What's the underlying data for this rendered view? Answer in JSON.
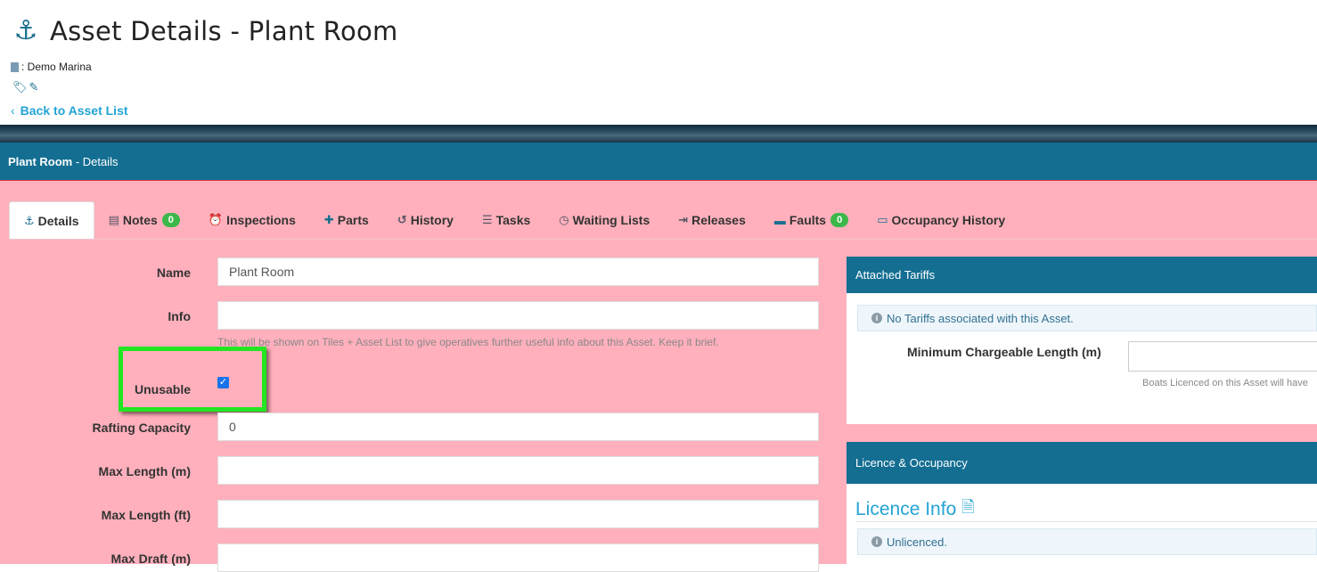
{
  "header": {
    "title": "Asset Details - Plant Room",
    "site": ": Demo Marina",
    "back_link": "Back to Asset List"
  },
  "panel": {
    "asset_name": "Plant Room",
    "suffix": " - Details"
  },
  "tabs": [
    {
      "label": "Details",
      "icon": "anchor-icon",
      "active": true
    },
    {
      "label": "Notes",
      "icon": "document-icon",
      "badge": "0"
    },
    {
      "label": "Inspections",
      "icon": "alarm-clock-icon"
    },
    {
      "label": "Parts",
      "icon": "puzzle-icon"
    },
    {
      "label": "History",
      "icon": "history-icon"
    },
    {
      "label": "Tasks",
      "icon": "checklist-icon"
    },
    {
      "label": "Waiting Lists",
      "icon": "clock-icon"
    },
    {
      "label": "Releases",
      "icon": "sign-out-icon"
    },
    {
      "label": "Faults",
      "icon": "bus-icon",
      "badge": "0"
    },
    {
      "label": "Occupancy History",
      "icon": "bed-icon"
    }
  ],
  "form": {
    "name_label": "Name",
    "name_value": "Plant Room",
    "info_label": "Info",
    "info_value": "",
    "info_help": "This will be shown on Tiles + Asset List to give operatives further useful info about this Asset. Keep it brief.",
    "unusable_label": "Unusable",
    "unusable_checked": true,
    "rafting_label": "Rafting Capacity",
    "rafting_value": "0",
    "maxlen_m_label": "Max Length (m)",
    "maxlen_ft_label": "Max Length (ft)",
    "maxdraft_label": "Max Draft (m)"
  },
  "tariffs": {
    "heading": "Attached Tariffs",
    "info": "No Tariffs associated with this Asset.",
    "min_length_label": "Minimum Chargeable Length (m)",
    "min_length_help": "Boats Licenced on this Asset will have"
  },
  "licence": {
    "heading": "Licence & Occupancy",
    "title": "Licence Info",
    "status": "Unlicenced."
  },
  "colors": {
    "panel_bar": "#136e92",
    "unusable_background": "#ffb0bc",
    "link": "#23a4d5",
    "badge": "#3cb84a",
    "highlight": "#22e622"
  }
}
